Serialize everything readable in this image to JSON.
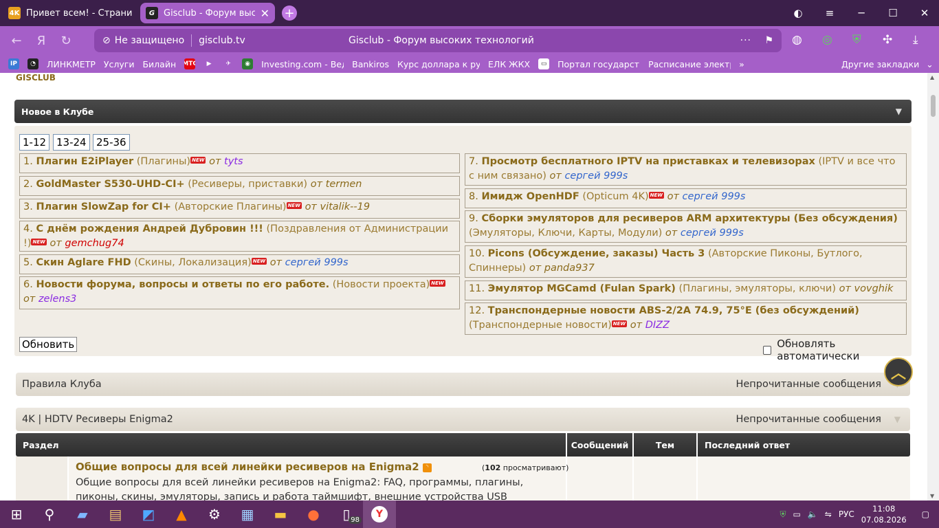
{
  "browser": {
    "tabs": [
      {
        "title": "Привет всем! - Страница",
        "favicon": "4K",
        "favicon_bg": "#e8a020"
      },
      {
        "title": "Gisclub - Форум высоких",
        "favicon": "G",
        "favicon_bg": "#222"
      }
    ],
    "address": {
      "security": "Не защищено",
      "host": "gisclub.tv",
      "page_title": "Gisclub - Форум высоких технологий"
    },
    "bookmarks": [
      {
        "label": "",
        "icon": "IP",
        "bg": "#3a7bd5"
      },
      {
        "label": "",
        "icon": "◔",
        "bg": "#222"
      },
      {
        "label": "ЛИНКМЕТР",
        "icon": "",
        "bg": ""
      },
      {
        "label": "Услуги",
        "icon": "",
        "bg": ""
      },
      {
        "label": "Билайн",
        "icon": "",
        "bg": ""
      },
      {
        "label": "",
        "icon": "МТС",
        "bg": "#e30611"
      },
      {
        "label": "",
        "icon": "▶",
        "bg": "#a55fc8"
      },
      {
        "label": "",
        "icon": "✈",
        "bg": "#a55fc8"
      },
      {
        "label": "",
        "icon": "◉",
        "bg": "#2e7d32"
      },
      {
        "label": "Investing.com - Веду",
        "icon": "",
        "bg": ""
      },
      {
        "label": "Bankiros",
        "icon": "",
        "bg": ""
      },
      {
        "label": "Курс доллара к рубл",
        "icon": "",
        "bg": ""
      },
      {
        "label": "ЕЛК ЖКХ",
        "icon": "",
        "bg": ""
      },
      {
        "label": "",
        "icon": "▭",
        "bg": "#fff"
      },
      {
        "label": "Портал государстве",
        "icon": "",
        "bg": ""
      },
      {
        "label": "Расписание электри",
        "icon": "",
        "bg": ""
      }
    ],
    "more": "»",
    "other_bookmarks": "Другие закладки"
  },
  "site": {
    "logo": "GISCLUB",
    "news_header": "Новое в Клубе",
    "pager": [
      "1-12",
      "13-24",
      "25-36"
    ],
    "left_items": [
      {
        "n": "1.",
        "title": "Плагин E2iPlayer",
        "cat": "(Плагины)",
        "new": true,
        "by": "от",
        "user": "tyts",
        "user_color": "#8a2be2"
      },
      {
        "n": "2.",
        "title": "GoldMaster S530-UHD-CI+",
        "cat": "(Ресиверы, приставки)",
        "new": false,
        "by": "от",
        "user": "termen",
        "user_color": "#8a6a1a"
      },
      {
        "n": "3.",
        "title": "Плагин SlowZap for CI+",
        "cat": "(Авторские Плагины)",
        "new": true,
        "by": "от",
        "user": "vitalik--19",
        "user_color": "#8a6a1a"
      },
      {
        "n": "4.",
        "title": "С днём рождения Андрей Дубровин !!!",
        "cat": "(Поздравления от Администрации !)",
        "new": true,
        "by": "от",
        "user": "gemchug74",
        "user_color": "#d00000"
      },
      {
        "n": "5.",
        "title": "Скин Aglare FHD",
        "cat": "(Скины, Локализация)",
        "new": true,
        "by": "от",
        "user": "сергей 999s",
        "user_color": "#3366cc"
      },
      {
        "n": "6.",
        "title": "Новости форума, вопросы и ответы по его работе.",
        "cat": "(Новости проекта)",
        "new": true,
        "by": "от",
        "user": "zelens3",
        "user_color": "#8a2be2"
      }
    ],
    "right_items": [
      {
        "n": "7.",
        "title": "Просмотр бесплатного IPTV на приставках и телевизорах",
        "cat": "(IPTV и все что с ним связано)",
        "new": false,
        "by": "от",
        "user": "сергей 999s",
        "user_color": "#3366cc"
      },
      {
        "n": "8.",
        "title": "Имидж OpenHDF",
        "cat": "(Opticum 4K)",
        "new": true,
        "by": "от",
        "user": "сергей 999s",
        "user_color": "#3366cc"
      },
      {
        "n": "9.",
        "title": "Сборки эмуляторов для ресиверов ARM архитектуры (Без обсуждения)",
        "cat": "(Эмуляторы, Ключи, Карты, Модули)",
        "new": false,
        "by": "от",
        "user": "сергей 999s",
        "user_color": "#3366cc"
      },
      {
        "n": "10.",
        "title": "Picons (Обсуждение, заказы) Часть 3",
        "cat": "(Авторские Пиконы, Бутлого, Спиннеры)",
        "new": false,
        "by": "от",
        "user": "panda937",
        "user_color": "#8a6a1a"
      },
      {
        "n": "11.",
        "title": "Эмулятор MGCamd (Fulan Spark)",
        "cat": "(Плагины, эмуляторы, ключи)",
        "new": false,
        "by": "от",
        "user": "vovghik",
        "user_color": "#8a6a1a"
      },
      {
        "n": "12.",
        "title": "Транспондерные новости ABS-2/2A 74.9, 75°E (без обсуждений)",
        "cat": "(Транспондерные новости)",
        "new": true,
        "by": "от",
        "user": "DIZZ",
        "user_color": "#8a2be2"
      }
    ],
    "new_badge": "NEW",
    "refresh_button": "Обновить",
    "auto_refresh": "Обновлять автоматически",
    "sections": [
      {
        "title": "Правила Клуба",
        "right": "Непрочитанные сообщения"
      },
      {
        "title": "4K | HDTV Ресиверы Enigma2",
        "right": "Непрочитанные сообщения"
      }
    ],
    "table_headers": {
      "section": "Раздел",
      "posts": "Сообщений",
      "topics": "Тем",
      "last": "Последний ответ"
    },
    "forum_row": {
      "title": "Общие вопросы для всей линейки ресиверов на Enigma2",
      "viewers_count": "102",
      "viewers_label": "просматривают)",
      "viewers_open": "(",
      "description": "Общие вопросы для всей линейки ресиверов на Enigma2: FAQ, программы, плагины, пиконы, скины, эмуляторы, запись и работа таймшифт, внешние устройства USB"
    }
  },
  "taskbar": {
    "badge": "98",
    "lang": "РУС",
    "time": "11:08",
    "date": "07.08.2026"
  }
}
